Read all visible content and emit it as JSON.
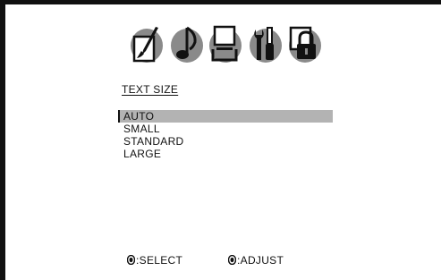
{
  "menu": {
    "icons": [
      "paintbrush-icon",
      "music-note-icon",
      "display-icon",
      "tools-icon",
      "lock-icon"
    ],
    "title": "TEXT SIZE",
    "options": [
      {
        "label": "AUTO",
        "selected": true
      },
      {
        "label": "SMALL",
        "selected": false
      },
      {
        "label": "STANDARD",
        "selected": false
      },
      {
        "label": "LARGE",
        "selected": false
      }
    ]
  },
  "footer": {
    "select_label": ":SELECT",
    "adjust_label": ":ADJUST"
  },
  "colors": {
    "highlight": "#b3b3b3",
    "icon_gray": "#8a8a8a",
    "text": "#111111"
  }
}
